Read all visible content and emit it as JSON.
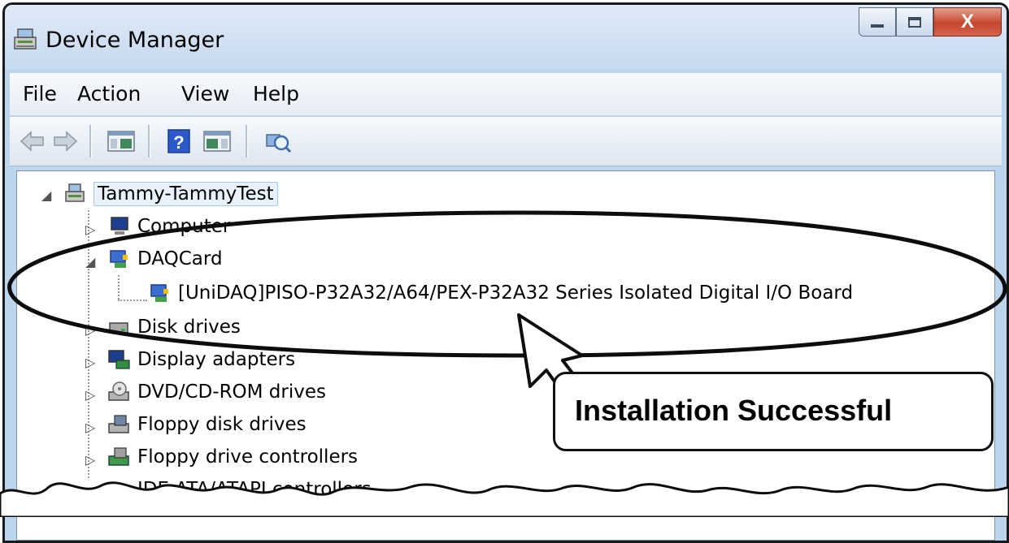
{
  "window": {
    "title": "Device Manager",
    "close_label": "X"
  },
  "menu": {
    "items": [
      "File",
      "Action",
      "View",
      "Help"
    ]
  },
  "toolbar": {
    "buttons": [
      "back-arrow-icon",
      "forward-arrow-icon",
      "show-hide-console-tree-icon",
      "help-icon",
      "action-pane-icon",
      "scan-hardware-icon"
    ]
  },
  "tree": {
    "root": "Tammy-TammyTest",
    "items": [
      {
        "label": "Computer",
        "icon": "computer-icon",
        "state": "collapsed"
      },
      {
        "label": "DAQCard",
        "icon": "daq-card-icon",
        "state": "expanded"
      },
      {
        "label": "[UniDAQ]PISO-P32A32/A64/PEX-P32A32 Series Isolated Digital I/O Board",
        "icon": "daq-device-icon",
        "state": "leaf"
      },
      {
        "label": "Disk drives",
        "icon": "disk-drive-icon",
        "state": "collapsed"
      },
      {
        "label": "Display adapters",
        "icon": "display-adapter-icon",
        "state": "collapsed"
      },
      {
        "label": "DVD/CD-ROM drives",
        "icon": "dvd-drive-icon",
        "state": "collapsed"
      },
      {
        "label": "Floppy disk drives",
        "icon": "floppy-drive-icon",
        "state": "collapsed"
      },
      {
        "label": "Floppy drive controllers",
        "icon": "floppy-controller-icon",
        "state": "collapsed"
      },
      {
        "label": "IDE ATA/ATAPI controllers",
        "icon": "ide-controller-icon",
        "state": "collapsed"
      }
    ]
  },
  "annotation": {
    "text": "Installation Successful"
  },
  "colors": {
    "frame": "#bcd4ec",
    "close_button": "#c5452e",
    "annotation_stroke": "#111111"
  }
}
